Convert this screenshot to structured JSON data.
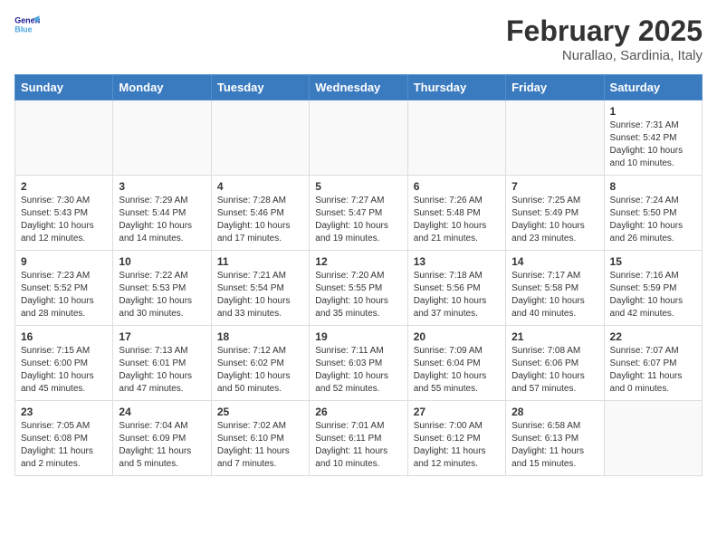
{
  "header": {
    "logo_line1": "General",
    "logo_line2": "Blue",
    "month_year": "February 2025",
    "location": "Nurallao, Sardinia, Italy"
  },
  "weekdays": [
    "Sunday",
    "Monday",
    "Tuesday",
    "Wednesday",
    "Thursday",
    "Friday",
    "Saturday"
  ],
  "weeks": [
    [
      {
        "day": "",
        "info": ""
      },
      {
        "day": "",
        "info": ""
      },
      {
        "day": "",
        "info": ""
      },
      {
        "day": "",
        "info": ""
      },
      {
        "day": "",
        "info": ""
      },
      {
        "day": "",
        "info": ""
      },
      {
        "day": "1",
        "info": "Sunrise: 7:31 AM\nSunset: 5:42 PM\nDaylight: 10 hours and 10 minutes."
      }
    ],
    [
      {
        "day": "2",
        "info": "Sunrise: 7:30 AM\nSunset: 5:43 PM\nDaylight: 10 hours and 12 minutes."
      },
      {
        "day": "3",
        "info": "Sunrise: 7:29 AM\nSunset: 5:44 PM\nDaylight: 10 hours and 14 minutes."
      },
      {
        "day": "4",
        "info": "Sunrise: 7:28 AM\nSunset: 5:46 PM\nDaylight: 10 hours and 17 minutes."
      },
      {
        "day": "5",
        "info": "Sunrise: 7:27 AM\nSunset: 5:47 PM\nDaylight: 10 hours and 19 minutes."
      },
      {
        "day": "6",
        "info": "Sunrise: 7:26 AM\nSunset: 5:48 PM\nDaylight: 10 hours and 21 minutes."
      },
      {
        "day": "7",
        "info": "Sunrise: 7:25 AM\nSunset: 5:49 PM\nDaylight: 10 hours and 23 minutes."
      },
      {
        "day": "8",
        "info": "Sunrise: 7:24 AM\nSunset: 5:50 PM\nDaylight: 10 hours and 26 minutes."
      }
    ],
    [
      {
        "day": "9",
        "info": "Sunrise: 7:23 AM\nSunset: 5:52 PM\nDaylight: 10 hours and 28 minutes."
      },
      {
        "day": "10",
        "info": "Sunrise: 7:22 AM\nSunset: 5:53 PM\nDaylight: 10 hours and 30 minutes."
      },
      {
        "day": "11",
        "info": "Sunrise: 7:21 AM\nSunset: 5:54 PM\nDaylight: 10 hours and 33 minutes."
      },
      {
        "day": "12",
        "info": "Sunrise: 7:20 AM\nSunset: 5:55 PM\nDaylight: 10 hours and 35 minutes."
      },
      {
        "day": "13",
        "info": "Sunrise: 7:18 AM\nSunset: 5:56 PM\nDaylight: 10 hours and 37 minutes."
      },
      {
        "day": "14",
        "info": "Sunrise: 7:17 AM\nSunset: 5:58 PM\nDaylight: 10 hours and 40 minutes."
      },
      {
        "day": "15",
        "info": "Sunrise: 7:16 AM\nSunset: 5:59 PM\nDaylight: 10 hours and 42 minutes."
      }
    ],
    [
      {
        "day": "16",
        "info": "Sunrise: 7:15 AM\nSunset: 6:00 PM\nDaylight: 10 hours and 45 minutes."
      },
      {
        "day": "17",
        "info": "Sunrise: 7:13 AM\nSunset: 6:01 PM\nDaylight: 10 hours and 47 minutes."
      },
      {
        "day": "18",
        "info": "Sunrise: 7:12 AM\nSunset: 6:02 PM\nDaylight: 10 hours and 50 minutes."
      },
      {
        "day": "19",
        "info": "Sunrise: 7:11 AM\nSunset: 6:03 PM\nDaylight: 10 hours and 52 minutes."
      },
      {
        "day": "20",
        "info": "Sunrise: 7:09 AM\nSunset: 6:04 PM\nDaylight: 10 hours and 55 minutes."
      },
      {
        "day": "21",
        "info": "Sunrise: 7:08 AM\nSunset: 6:06 PM\nDaylight: 10 hours and 57 minutes."
      },
      {
        "day": "22",
        "info": "Sunrise: 7:07 AM\nSunset: 6:07 PM\nDaylight: 11 hours and 0 minutes."
      }
    ],
    [
      {
        "day": "23",
        "info": "Sunrise: 7:05 AM\nSunset: 6:08 PM\nDaylight: 11 hours and 2 minutes."
      },
      {
        "day": "24",
        "info": "Sunrise: 7:04 AM\nSunset: 6:09 PM\nDaylight: 11 hours and 5 minutes."
      },
      {
        "day": "25",
        "info": "Sunrise: 7:02 AM\nSunset: 6:10 PM\nDaylight: 11 hours and 7 minutes."
      },
      {
        "day": "26",
        "info": "Sunrise: 7:01 AM\nSunset: 6:11 PM\nDaylight: 11 hours and 10 minutes."
      },
      {
        "day": "27",
        "info": "Sunrise: 7:00 AM\nSunset: 6:12 PM\nDaylight: 11 hours and 12 minutes."
      },
      {
        "day": "28",
        "info": "Sunrise: 6:58 AM\nSunset: 6:13 PM\nDaylight: 11 hours and 15 minutes."
      },
      {
        "day": "",
        "info": ""
      }
    ]
  ]
}
